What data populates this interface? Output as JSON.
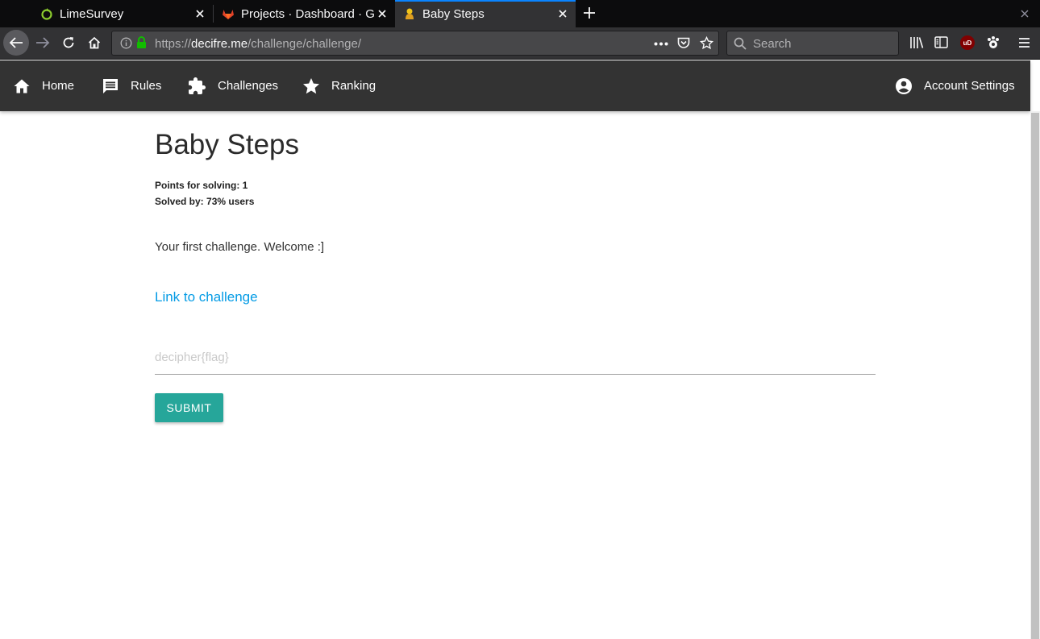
{
  "browser": {
    "tabs": [
      {
        "title": "LimeSurvey",
        "icon": "limesurvey-icon",
        "active": false
      },
      {
        "title": "Projects · Dashboard · Gi",
        "icon": "gitlab-icon",
        "active": false
      },
      {
        "title": "Baby Steps",
        "icon": "baby-icon",
        "active": true
      }
    ],
    "url_scheme": "https://",
    "url_host": "decifre.me",
    "url_path": "/challenge/challenge/",
    "search_placeholder": "Search",
    "ublock_label": "uD"
  },
  "site_nav": {
    "items": [
      {
        "label": "Home",
        "icon": "home-icon"
      },
      {
        "label": "Rules",
        "icon": "comment-icon"
      },
      {
        "label": "Challenges",
        "icon": "puzzle-icon"
      },
      {
        "label": "Ranking",
        "icon": "star-icon"
      }
    ],
    "account_label": "Account Settings"
  },
  "challenge": {
    "title": "Baby Steps",
    "points_line": "Points for solving: 1",
    "solved_line": "Solved by: 73% users",
    "description": "Your first challenge. Welcome :]",
    "link_text": "Link to challenge",
    "flag_placeholder": "decipher{flag}",
    "flag_value": "",
    "submit_label": "SUBMIT"
  },
  "colors": {
    "header_bg": "#333333",
    "link": "#039be5",
    "submit_bg": "#26a69a",
    "tab_accent": "#0a84ff"
  }
}
